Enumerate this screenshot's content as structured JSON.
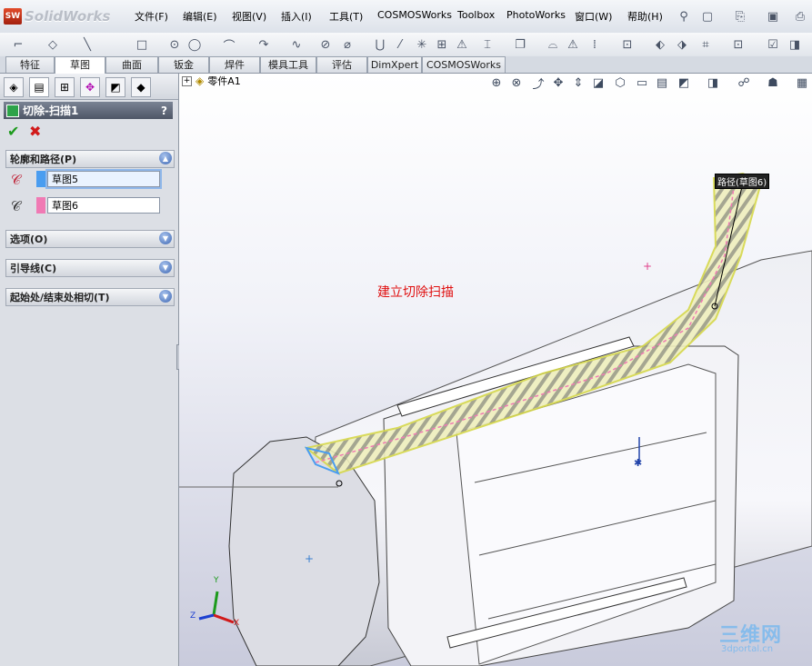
{
  "app": {
    "logo_text": "SolidWorks",
    "logo_badge": "SW"
  },
  "menus": [
    "文件(F)",
    "编辑(E)",
    "视图(V)",
    "插入(I)",
    "工具(T)",
    "COSMOSWorks",
    "Toolbox",
    "PhotoWorks",
    "窗口(W)",
    "帮助(H)"
  ],
  "tabs": [
    "特征",
    "草图",
    "曲面",
    "钣金",
    "焊件",
    "模具工具",
    "评估",
    "DimXpert",
    "COSMOSWorks"
  ],
  "active_tab": "草图",
  "property_manager": {
    "title": "切除-扫描1",
    "help": "?",
    "ok_icon": "check-icon",
    "cancel_icon": "close-icon",
    "sections": {
      "profile_path": {
        "label": "轮廓和路径(P)",
        "profile_value": "草图5",
        "path_value": "草图6",
        "profile_color": "#4a9df0",
        "path_color": "#f07ab4"
      },
      "options": {
        "label": "选项(O)"
      },
      "guides": {
        "label": "引导线(C)"
      },
      "tangency": {
        "label": "起始处/结束处相切(T)"
      }
    }
  },
  "viewport": {
    "part_name": "零件A1",
    "annotation": "建立切除扫描",
    "path_label": "路径(草图6)",
    "triad": {
      "x": "X",
      "y": "Y",
      "z": "Z"
    },
    "watermark": "三维网",
    "watermark_url": "3dportal.cn"
  },
  "colors": {
    "accent": "#3e67b3",
    "annotation": "#e01010",
    "sweep": "#ecef9c"
  }
}
